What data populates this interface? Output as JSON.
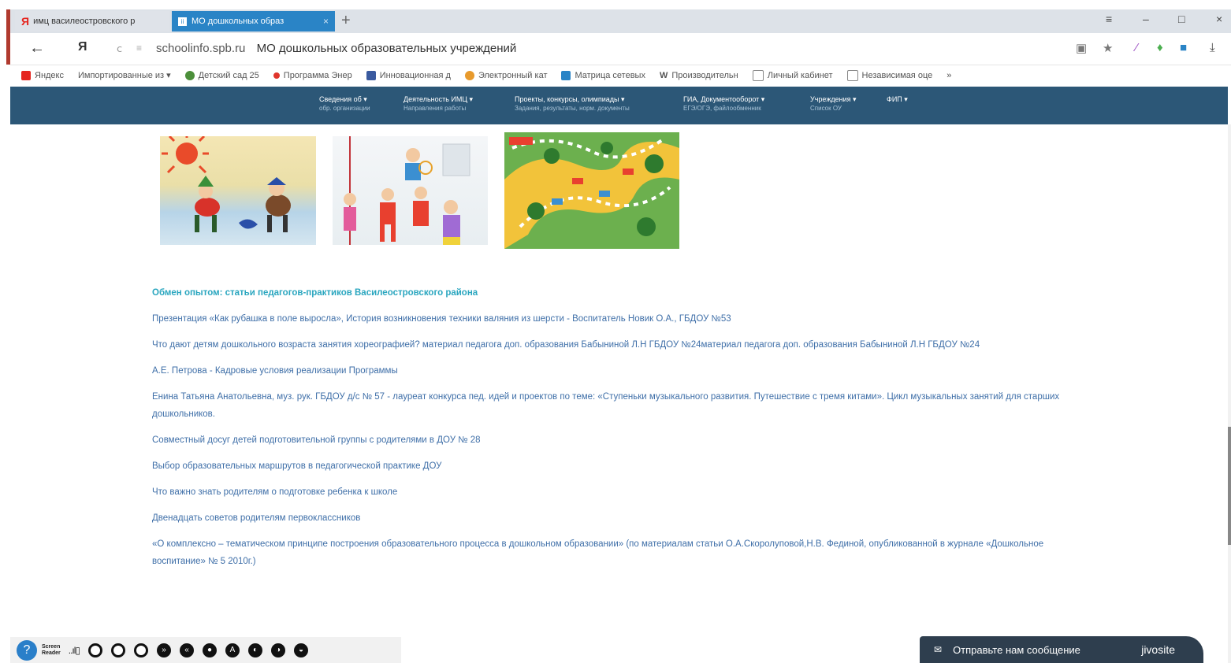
{
  "browser": {
    "tabs": [
      {
        "label": "имц василеостровского р",
        "icon": "yandex-icon"
      },
      {
        "label": "МО дошкольных образ",
        "icon": "site-icon"
      }
    ],
    "new_tab": "+",
    "window_controls": {
      "menu": "≡",
      "minimize": "–",
      "maximize": "□",
      "close": "×"
    },
    "address": {
      "host": "schoolinfo.spb.ru",
      "title": "МО дошкольных образовательных учреждений"
    },
    "bookmarks": [
      {
        "label": "Яндекс",
        "color": "#e52620"
      },
      {
        "label": "Импортированные из ▾",
        "color": "#ffffff"
      },
      {
        "label": "Детский сад 25",
        "color": "#4c8f3a"
      },
      {
        "label": "Программа Энер",
        "color": "#e0352b"
      },
      {
        "label": "Инновационная д",
        "color": "#3a5a9f"
      },
      {
        "label": "Электронный кат",
        "color": "#e89a2c"
      },
      {
        "label": "Матрица сетевых",
        "color": "#2a84c6"
      },
      {
        "label": "Производительн",
        "color": "#555555"
      },
      {
        "label": "Личный кабинет",
        "color": "#888888"
      },
      {
        "label": "Независимая оце",
        "color": "#888888"
      },
      {
        "label": "»",
        "color": "#ffffff"
      }
    ]
  },
  "site_nav": [
    {
      "label": "Сведения об ▾",
      "sub": "обр. организации"
    },
    {
      "label": "Деятельность ИМЦ ▾",
      "sub": "Направления работы"
    },
    {
      "label": "Проекты, конкурсы, олимпиады ▾",
      "sub": "Задания, результаты, норм. документы"
    },
    {
      "label": "ГИА, Документооборот ▾",
      "sub": "ЕГЭ/ОГЭ, файлообменник"
    },
    {
      "label": "Учреждения ▾",
      "sub": "Список ОУ"
    },
    {
      "label": "ФИП ▾",
      "sub": ""
    }
  ],
  "content": {
    "heading": "Обмен опытом: статьи педагогов-практиков Василеостровского района",
    "links": [
      "Презентация «Как рубашка в поле выросла», История возникновения техники валяния из шерсти - Воспитатель Новик О.А., ГБДОУ №53",
      "Что дают детям дошкольного возраста занятия хореографией? материал педагога доп. образования Бабыниной Л.Н ГБДОУ №24материал педагога доп. образования Бабыниной Л.Н ГБДОУ №24",
      "А.Е. Петрова - Кадровые условия реализации Программы",
      "Енина Татьяна Анатольевна, муз. рук. ГБДОУ д/с № 57 - лауреат конкурса пед. идей и проектов по теме: «Ступеньки музыкального развития. Путешествие с тремя китами». Цикл музыкальных занятий для старших дошкольников.",
      "Совместный досуг детей подготовительной группы с родителями в ДОУ № 28",
      "Выбор образовательных маршрутов в педагогической практике ДОУ",
      "Что важно знать родителям о подготовке ребенка к школе",
      "Двенадцать советов родителям первоклассников",
      "«О комплексно – тематическом принципе построения образовательного процесса в дошкольном образовании» (по материалам статьи О.А.Скоролуповой,Н.В. Фединой, опубликованной в журнале «Дошкольное воспитание» № 5 2010г.)"
    ]
  },
  "screen_reader": {
    "label_line1": "Screen",
    "label_line2": "Reader"
  },
  "jivo": {
    "message": "Отправьте нам сообщение",
    "brand": "jivosite"
  }
}
